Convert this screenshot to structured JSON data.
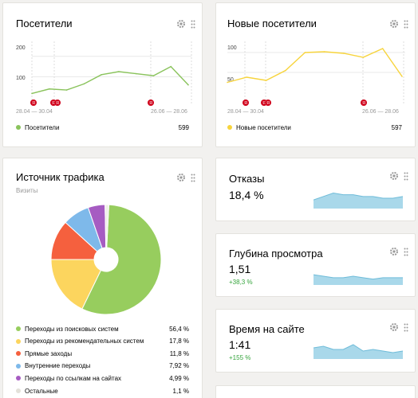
{
  "visitors": {
    "title": "Посетители",
    "y_ticks": [
      "200",
      "100"
    ],
    "dates": [
      "28.04 — 30.04",
      "26.06 — 28.06"
    ],
    "legend_label": "Посетители",
    "legend_value": "599",
    "color": "#8ac35c"
  },
  "new_visitors": {
    "title": "Новые посетители",
    "y_ticks": [
      "100",
      "50"
    ],
    "dates": [
      "28.04 — 30.04",
      "26.06 — 28.06"
    ],
    "legend_label": "Новые посетители",
    "legend_value": "597",
    "color": "#f7d43c"
  },
  "traffic": {
    "title": "Источник трафика",
    "subtitle": "Визиты",
    "items": [
      {
        "label": "Переходы из поисковых систем",
        "value": "56,4 %",
        "color": "#97cd5e"
      },
      {
        "label": "Переходы из рекомендательных систем",
        "value": "17,8 %",
        "color": "#fcd55e"
      },
      {
        "label": "Прямые заходы",
        "value": "11,8 %",
        "color": "#f5603e"
      },
      {
        "label": "Внутренние переходы",
        "value": "7,92 %",
        "color": "#7eb9ea"
      },
      {
        "label": "Переходы по ссылкам на сайтах",
        "value": "4,99 %",
        "color": "#a65cc2"
      },
      {
        "label": "Остальные",
        "value": "1,1 %",
        "color": "#f0efe9"
      }
    ]
  },
  "bounce": {
    "title": "Отказы",
    "value": "18,4 %"
  },
  "depth": {
    "title": "Глубина просмотра",
    "value": "1,51",
    "delta": "+38,3 %"
  },
  "time": {
    "title": "Время на сайте",
    "value": "1:41",
    "delta": "+155 %"
  },
  "chart_data": [
    {
      "type": "line",
      "title": "Посетители",
      "x": [
        0,
        1,
        2,
        3,
        4,
        5,
        6,
        7,
        8,
        9
      ],
      "series": [
        {
          "name": "Посетители",
          "values": [
            18,
            40,
            35,
            65,
            110,
            125,
            115,
            105,
            150,
            60
          ]
        }
      ],
      "ylim": [
        0,
        250
      ],
      "grid": true
    },
    {
      "type": "line",
      "title": "Новые посетители",
      "x": [
        0,
        1,
        2,
        3,
        4,
        5,
        6,
        7,
        8,
        9
      ],
      "series": [
        {
          "name": "Новые посетители",
          "values": [
            25,
            38,
            30,
            55,
            100,
            102,
            98,
            88,
            110,
            40
          ]
        }
      ],
      "ylim": [
        0,
        120
      ],
      "grid": true
    },
    {
      "type": "pie",
      "title": "Источник трафика",
      "categories": [
        "Переходы из поисковых систем",
        "Переходы из рекомендательных систем",
        "Прямые заходы",
        "Внутренние переходы",
        "Переходы по ссылкам на сайтах",
        "Остальные"
      ],
      "values": [
        56.4,
        17.8,
        11.8,
        7.92,
        4.99,
        1.1
      ]
    },
    {
      "type": "area",
      "title": "Отказы",
      "values": [
        5,
        7,
        9,
        8,
        8,
        7,
        7,
        6,
        6,
        7
      ]
    },
    {
      "type": "area",
      "title": "Глубина просмотра",
      "values": [
        7,
        6,
        5,
        5,
        6,
        5,
        4,
        5,
        5,
        5
      ]
    },
    {
      "type": "area",
      "title": "Время на сайте",
      "values": [
        7,
        8,
        6,
        6,
        9,
        5,
        6,
        5,
        4,
        5
      ]
    }
  ]
}
